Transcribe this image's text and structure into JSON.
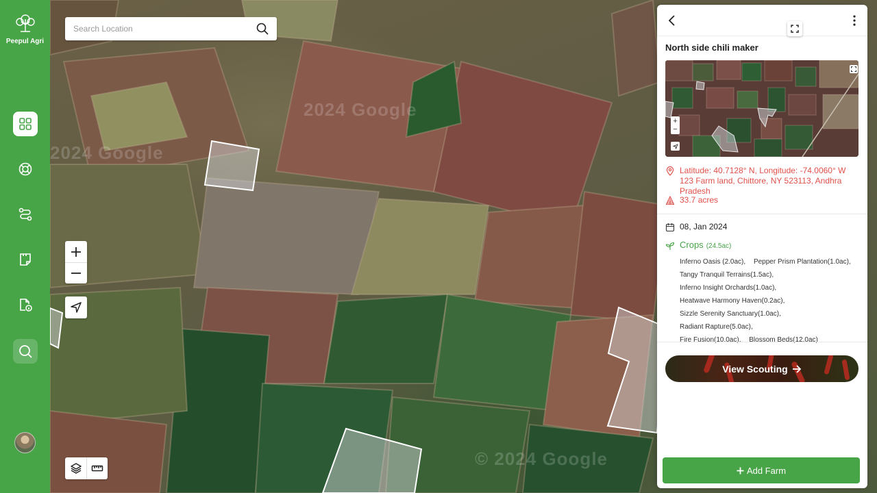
{
  "brand": {
    "name": "Peepul Agri",
    "color": "#47a447"
  },
  "sidebar": {
    "items": [
      {
        "name": "dashboard",
        "icon": "grid-icon",
        "active": true
      },
      {
        "name": "support",
        "icon": "lifebuoy-icon",
        "active": false
      },
      {
        "name": "routes",
        "icon": "route-icon",
        "active": false
      },
      {
        "name": "reports",
        "icon": "document-icon",
        "active": false
      },
      {
        "name": "info",
        "icon": "file-info-icon",
        "active": false
      },
      {
        "name": "search",
        "icon": "search-icon",
        "active": false
      }
    ]
  },
  "search": {
    "placeholder": "Search Location",
    "value": ""
  },
  "map": {
    "watermarks": [
      "2024 Google",
      "2024 Google",
      "© 2024 Google"
    ],
    "controls": {
      "zoom_in": "+",
      "zoom_out": "−"
    }
  },
  "panel": {
    "farm_name": "North side chili maker",
    "location": "Latitude: 40.7128° N, Longitude: -74.0060° W 123 Farm land, Chittore, NY 523113, Andhra Pradesh",
    "area": "33.7 acres",
    "date": "08, Jan 2024",
    "crops_label": "Crops",
    "crops_total": "(24.5ac)",
    "crops": [
      "Inferno Oasis (2.0ac),",
      "Pepper Prism Plantation(1.0ac),",
      "Tangy Tranquil Terrains(1.5ac),",
      "Inferno Insight Orchards(1.0ac),",
      "Heatwave Harmony Haven(0.2ac),",
      "Sizzle Serenity Sanctuary(1.0ac),",
      "Radiant Rapture(5.0ac),",
      "Fire Fusion(10.0ac),",
      "Blossom Beds(12.0ac)"
    ],
    "view_scouting": "View Scouting",
    "add_farm": "Add Farm",
    "mini_map": {
      "zoom_in": "+",
      "zoom_out": "−"
    }
  },
  "colors": {
    "accent": "#47a447",
    "alert": "#e0504a"
  }
}
